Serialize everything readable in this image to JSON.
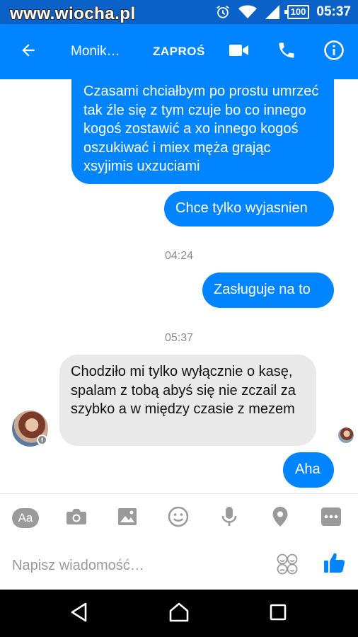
{
  "status_bar": {
    "watermark": "www.wiocha.pl",
    "battery": "100",
    "time": "05:37",
    "icons": [
      "alarm-icon",
      "wifi-icon",
      "signal-icon",
      "battery-icon"
    ]
  },
  "app_bar": {
    "contact_name": "Monik…",
    "invite_label": "ZAPROŚ",
    "icons": [
      "back-arrow-icon",
      "video-camera-icon",
      "phone-icon",
      "info-icon"
    ],
    "color": "#0084ff"
  },
  "messages": [
    {
      "direction": "outgoing",
      "text": "Czasami chciałbym po prostu umrzeć tak źle się z tym czuje bo co innego kogoś zostawić a xo innego kogoś oszukiwać i miex męża grając xsyjimis uxzuciami"
    },
    {
      "direction": "outgoing",
      "text": "Chce tylko wyjasnien"
    },
    {
      "type": "timestamp",
      "text": "04:24"
    },
    {
      "direction": "outgoing",
      "text": "Zasługuje na to"
    },
    {
      "type": "timestamp",
      "text": "05:37"
    },
    {
      "direction": "incoming",
      "text": "Chodziło mi tylko wyłącznie o kasę, spalam z tobą abyś się nie zczail za szybko a w między czasie z mezem"
    },
    {
      "direction": "outgoing",
      "text": "Aha"
    }
  ],
  "composer": {
    "aa_label": "Aa",
    "placeholder": "Napisz wiadomość…",
    "tools": [
      "text-format-icon",
      "camera-icon",
      "image-icon",
      "emoji-icon",
      "microphone-icon",
      "location-icon",
      "more-icon"
    ]
  },
  "nav_bar": {
    "icons": [
      "nav-back-icon",
      "nav-home-icon",
      "nav-recents-icon"
    ]
  },
  "colors": {
    "status_bar": "#0a62c9",
    "outgoing_bubble": "#0084ff",
    "incoming_bubble": "#e9e9e9",
    "icon_gray": "#9a9a9a"
  }
}
